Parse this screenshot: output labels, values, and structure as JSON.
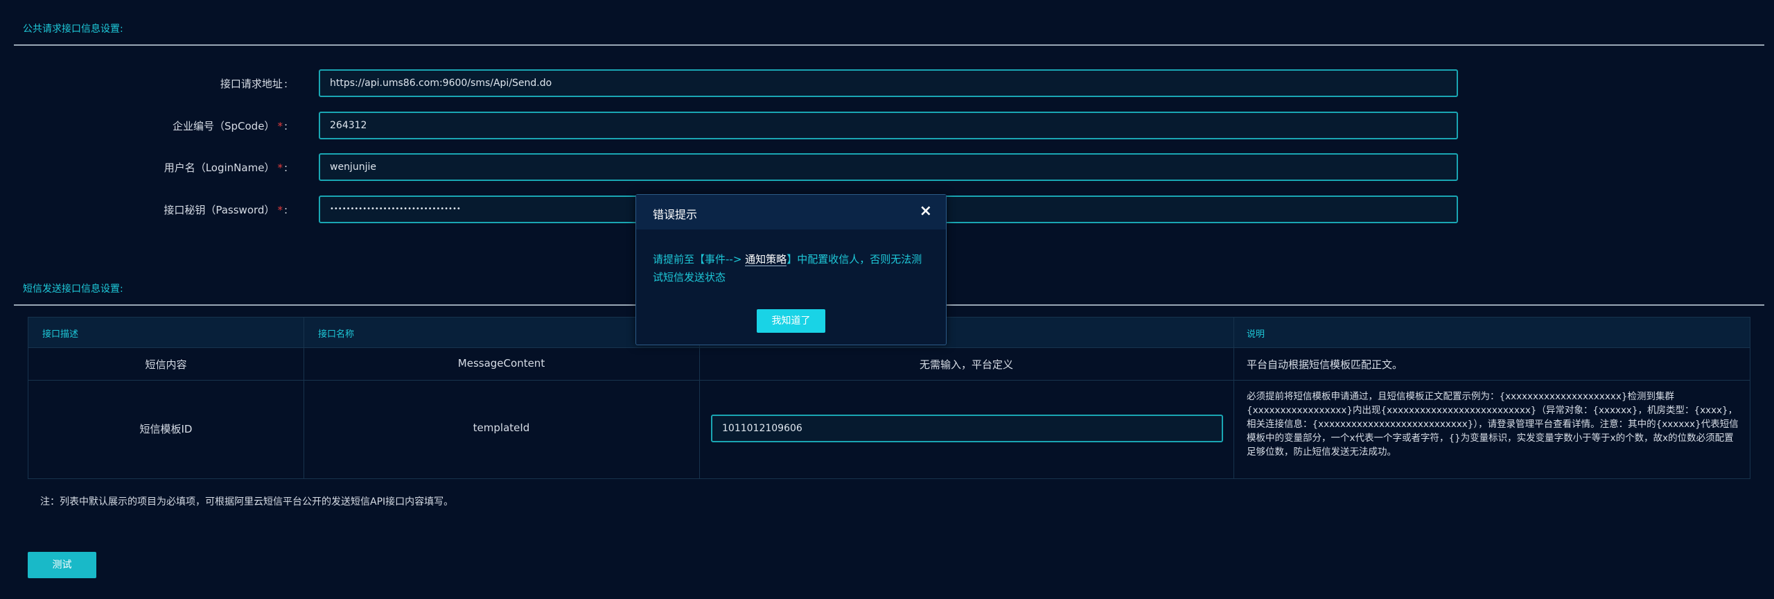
{
  "sections": {
    "public_title": "公共请求接口信息设置:",
    "sms_title": "短信发送接口信息设置:"
  },
  "form": {
    "fields": [
      {
        "label": "接口请求地址",
        "required": false,
        "value": "https://api.ums86.com:9600/sms/Api/Send.do"
      },
      {
        "label": "企业编号（SpCode）",
        "required": true,
        "value": "264312"
      },
      {
        "label": "用户名（LoginName）",
        "required": true,
        "value": "wenjunjie"
      },
      {
        "label": "接口秘钥（Password）",
        "required": true,
        "value": "••••••••••••••••••••••••••••••••"
      }
    ],
    "colon": ":",
    "required_mark": "*"
  },
  "table": {
    "headers": [
      "接口描述",
      "接口名称",
      "",
      "说明"
    ],
    "rows": [
      {
        "desc": "短信内容",
        "name": "MessageContent",
        "value": "无需输入，平台定义",
        "note": "平台自动根据短信模板匹配正文。"
      },
      {
        "desc": "短信模板ID",
        "name": "templateId",
        "value": "1011012109606",
        "note": "必须提前将短信模板申请通过，且短信模板正文配置示例为：{xxxxxxxxxxxxxxxxxxxxx}检测到集群{xxxxxxxxxxxxxxxxx}内出现{xxxxxxxxxxxxxxxxxxxxxxxxxx}（异常对象：{xxxxxx}，机房类型：{xxxx}，相关连接信息：{xxxxxxxxxxxxxxxxxxxxxxxxxxx}），请登录管理平台查看详情。注意：其中的{xxxxxx}代表短信模板中的变量部分，一个x代表一个字或者字符，{}为变量标识，实发变量字数小于等于x的个数，故x的位数必须配置足够位数，防止短信发送无法成功。"
      }
    ]
  },
  "note": "注：列表中默认展示的项目为必填项，可根据阿里云短信平台公开的发送短信API接口内容填写。",
  "test_button": "测试",
  "modal": {
    "title": "错误提示",
    "close": "×",
    "message_pre": "请提前至【事件--> ",
    "message_link": "通知策略",
    "message_post": "】中配置收信人，否则无法测试短信发送状态",
    "confirm": "我知道了"
  },
  "colors": {
    "accent": "#1ec8d8",
    "background": "#041026",
    "button": "#19b9c8",
    "required": "#e03b3b"
  }
}
